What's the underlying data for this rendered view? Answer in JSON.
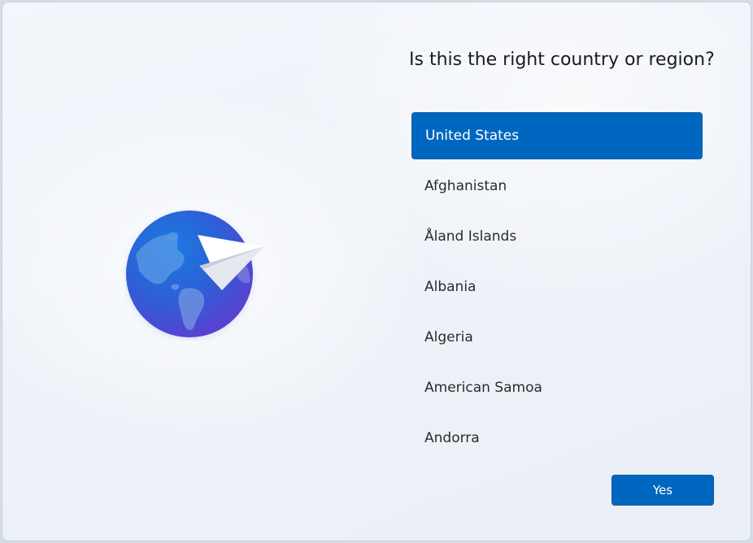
{
  "dialog": {
    "title": "Is this the right country or region?"
  },
  "illustration": {
    "icon": "globe-paper-plane-icon"
  },
  "countries": [
    {
      "label": "United States",
      "selected": true
    },
    {
      "label": "Afghanistan",
      "selected": false
    },
    {
      "label": "Åland Islands",
      "selected": false
    },
    {
      "label": "Albania",
      "selected": false
    },
    {
      "label": "Algeria",
      "selected": false
    },
    {
      "label": "American Samoa",
      "selected": false
    },
    {
      "label": "Andorra",
      "selected": false
    }
  ],
  "actions": {
    "confirm_label": "Yes"
  },
  "colors": {
    "accent": "#0067c0",
    "background": "#eef2f8"
  }
}
